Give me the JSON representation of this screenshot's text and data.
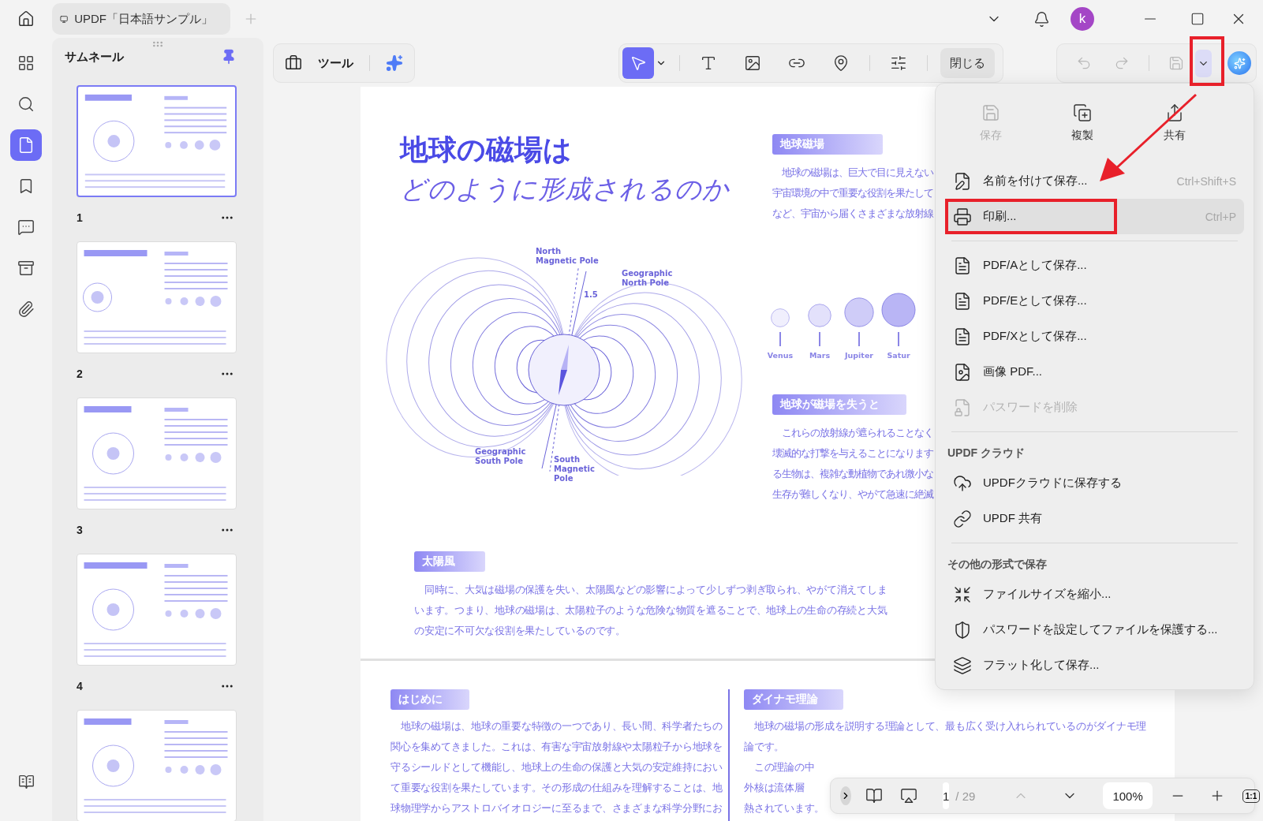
{
  "titlebar": {
    "tab_title": "UPDF「日本語サンプル」",
    "avatar_initial": "k"
  },
  "rail": {
    "items": [
      {
        "selected": false
      },
      {
        "selected": false
      },
      {
        "selected": true
      },
      {
        "selected": false
      },
      {
        "selected": false
      },
      {
        "selected": false
      },
      {
        "selected": false
      }
    ]
  },
  "thumbnail_panel": {
    "title": "サムネール",
    "pinned": true,
    "thumbnails": [
      {
        "label": "1",
        "selected": true
      },
      {
        "label": "2",
        "selected": false
      },
      {
        "label": "3",
        "selected": false
      },
      {
        "label": "4",
        "selected": false
      },
      {
        "selected": false
      }
    ]
  },
  "toolbar": {
    "tools_label": "ツール",
    "tools": [
      {
        "selected": true
      },
      {
        "selected": false
      },
      {
        "selected": false
      },
      {
        "selected": false
      },
      {
        "selected": false
      },
      {
        "selected": false
      }
    ],
    "close_label": "閉じる",
    "undo_disabled": true,
    "redo_disabled": true,
    "menu_caret_highlighted": true
  },
  "page1": {
    "title": "地球の磁場は",
    "subtitle": "どのように形成されるのか",
    "diagram_labels": [
      "North\nMagnetic Pole",
      "Geographic\nNorth Pole",
      "1.5",
      "Geographic\nSouth Pole",
      "South\nMagnetic\nPole"
    ],
    "magnetic_heading": "地球磁場",
    "magnetic_lines": [
      "　地球の磁場は、巨大で目に見えない",
      "宇宙環境の中で重要な役割を果たして",
      "など、宇宙から届くさまざまな放射線"
    ],
    "planets": [
      {
        "label": "Venus"
      },
      {
        "label": "Mars"
      },
      {
        "label": "Jupiter"
      },
      {
        "label": "Satur"
      }
    ],
    "loss_heading": "地球が磁場を失うと",
    "loss_lines": [
      "　これらの放射線が遮られることなく",
      "壊滅的な打撃を与えることになります",
      "る生物は、複雑な動植物であれ微小な",
      "生存が難しくなり、やがて急速に絶滅"
    ],
    "wind_heading": "太陽風",
    "wind_lines": [
      "　同時に、大気は磁場の保護を失い、太陽風などの影響によって少しずつ剥ぎ取られ、やがて消えてしま",
      "います。つまり、地球の磁場は、太陽粒子のような危険な物質を遮ることで、地球上の生命の存続と大気",
      "の安定に不可欠な役割を果たしているのです。"
    ]
  },
  "page2": {
    "intro_heading": "はじめに",
    "intro_lines": [
      "　地球の磁場は、地球の重要な特徴の一つであり、長い間、科学者たちの",
      "関心を集めてきました。これは、有害な宇宙放射線や太陽粒子から地球を",
      "守るシールドとして機能し、地球上の生命の保護と大気の安定維持におい",
      "て重要な役割を果たしています。その形成の仕組みを理解することは、地",
      "球物理学からアストロバイオロジーに至るまで、さまざまな科学分野にお"
    ],
    "dynamo_heading": "ダイナモ理論",
    "dynamo_paragraphs": [
      [
        "　地球の磁場の形成を説明する理論として、最も広く受け入れられているのがダイナモ理",
        "論です。"
      ],
      [
        "　この理論の中"
      ],
      [
        "外核は流体層"
      ],
      [
        "熱されています。"
      ]
    ]
  },
  "menu": {
    "top_actions": [
      {
        "label": "保存",
        "disabled": true
      },
      {
        "label": "複製",
        "disabled": false
      },
      {
        "label": "共有",
        "disabled": false
      }
    ],
    "sections": [
      {
        "items": [
          {
            "label": "名前を付けて保存...",
            "shortcut": "Ctrl+Shift+S",
            "disabled": false,
            "hovered": false,
            "highlighted": false
          },
          {
            "label": "印刷...",
            "shortcut": "Ctrl+P",
            "disabled": false,
            "hovered": true,
            "highlighted": true
          }
        ]
      },
      {
        "items": [
          {
            "label": "PDF/Aとして保存...",
            "disabled": false,
            "hovered": false,
            "highlighted": false
          },
          {
            "label": "PDF/Eとして保存...",
            "disabled": false,
            "hovered": false,
            "highlighted": false
          },
          {
            "label": "PDF/Xとして保存...",
            "disabled": false,
            "hovered": false,
            "highlighted": false
          },
          {
            "label": "画像 PDF...",
            "disabled": false,
            "hovered": false,
            "highlighted": false
          },
          {
            "label": "パスワードを削除",
            "disabled": true,
            "hovered": false,
            "highlighted": false
          }
        ]
      },
      {
        "heading": "UPDF クラウド",
        "items": [
          {
            "label": "UPDFクラウドに保存する",
            "disabled": false,
            "hovered": false,
            "highlighted": false
          },
          {
            "label": "UPDF 共有",
            "disabled": false,
            "hovered": false,
            "highlighted": false
          }
        ]
      },
      {
        "heading": "その他の形式で保存",
        "items": [
          {
            "label": "ファイルサイズを縮小...",
            "disabled": false,
            "hovered": false,
            "highlighted": false
          },
          {
            "label": "パスワードを設定してファイルを保護する...",
            "disabled": false,
            "hovered": false,
            "highlighted": false
          },
          {
            "label": "フラット化して保存...",
            "disabled": false,
            "hovered": false,
            "highlighted": false
          }
        ]
      }
    ]
  },
  "callout_arrow": true,
  "bottom_bar": {
    "page": "1",
    "total": "/ 29",
    "prev_disabled": true,
    "zoom": "100%",
    "actual_size": "1:1"
  }
}
